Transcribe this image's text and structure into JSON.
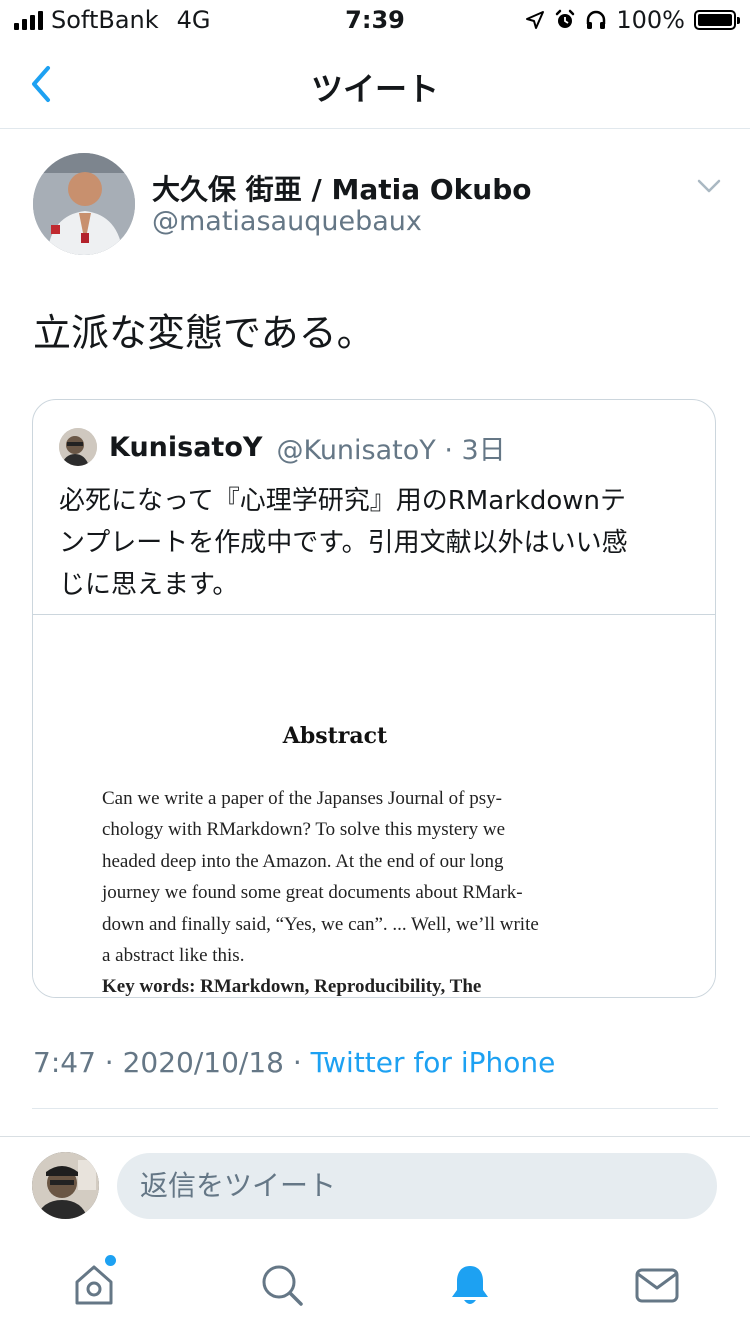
{
  "status_bar": {
    "carrier": "SoftBank",
    "network": "4G",
    "time": "7:39",
    "battery": "100%",
    "battery_level": 1.0
  },
  "header": {
    "title": "ツイート",
    "back_icon": "chevron-left-icon"
  },
  "tweet": {
    "author_name": "大久保 街亜 / Matia Okubo",
    "author_handle": "@matiasauquebaux",
    "text": "立派な変態である。",
    "timestamp": "7:47 · 2020/10/18 · ",
    "source": "Twitter for iPhone"
  },
  "quoted_tweet": {
    "author_name": "KunisatoY",
    "author_meta": "@KunisatoY · 3日",
    "text_lines": [
      "必死になって『心理学研究』用のRMarkdownテ",
      "ンプレートを作成中です。引用文献以外はいい感",
      "じに思えます。"
    ],
    "image": {
      "title": "Abstract",
      "lines": [
        "Can we write a paper of the Japanses Journal of psy-",
        "chology with RMarkdown?  To solve this mystery we",
        "headed deep into the Amazon.  At the end of our long",
        "journey we found some great documents about RMark-",
        "down and finally said, “Yes, we can”.  ... Well, we’ll write",
        "a abstract like this.",
        "Key  words:  RMarkdown,  Reproducibility,  The"
      ]
    }
  },
  "reply": {
    "placeholder": "返信をツイート"
  },
  "tabbar": {
    "tabs": [
      "home-icon",
      "search-icon",
      "notifications-icon",
      "messages-icon"
    ],
    "active": "notifications-icon",
    "accent": "#1da1f2"
  },
  "colors": {
    "accent": "#1da1f2",
    "secondary_text": "#657786",
    "border": "#ccd6dd"
  }
}
